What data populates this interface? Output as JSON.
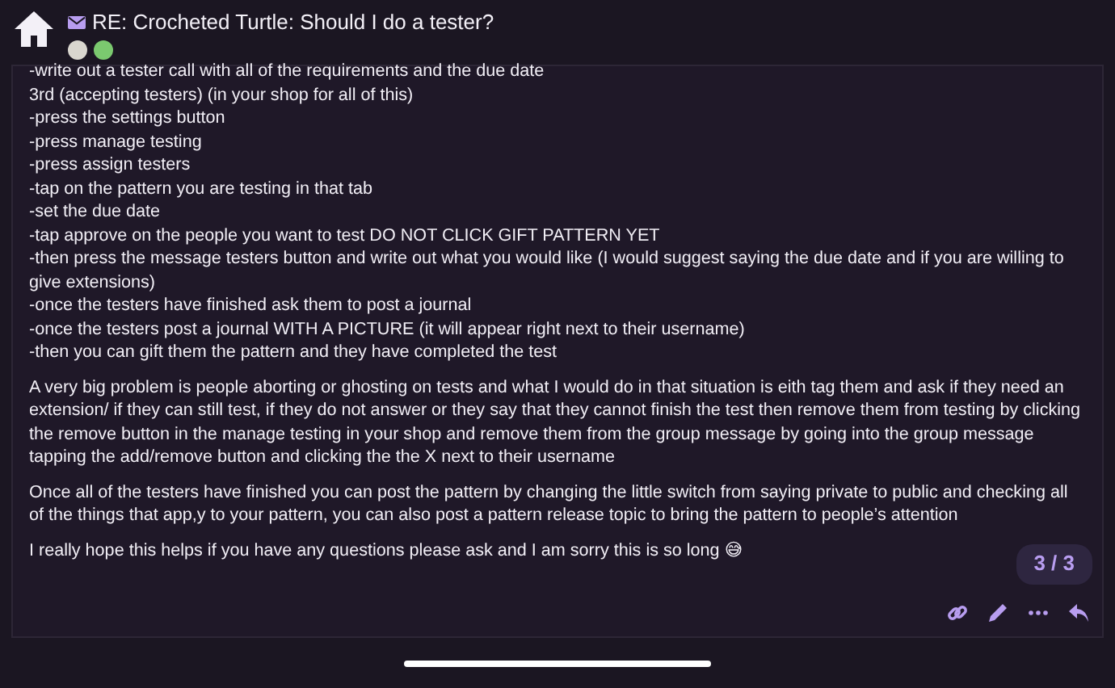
{
  "header": {
    "title": "RE: Crocheted Turtle: Should I do a tester?",
    "avatars": [
      {
        "color": "#d9d6cf"
      },
      {
        "color": "#7bc96f"
      }
    ]
  },
  "post": {
    "lines": [
      "-write out a tester call with all of the requirements and the due date",
      "3rd (accepting testers) (in your shop for all of this)",
      "-press the settings button",
      "-press manage testing",
      "-press assign testers",
      "-tap on the pattern you are testing in that tab",
      "-set the due date",
      "-tap approve on the people you want to test DO NOT CLICK GIFT PATTERN YET",
      "-then press the message testers button and write out what you would like (I would suggest saying the due date and if you are willing to give extensions)",
      "-once the testers have finished ask them to post a journal",
      "-once the testers post a journal WITH A PICTURE (it will appear right next to their username)",
      "-then you can gift them the pattern and they have completed the test"
    ],
    "paragraphs": [
      "A very big problem is people aborting or ghosting on tests and what I would do in that situation is eith tag them and ask if they need an extension/ if they can still test, if they do not answer or they say that they cannot finish the test then remove them from testing by clicking the remove button in the manage testing in your shop and remove them from the group message by going into the group message tapping the add/remove button and clicking the the X next to their username",
      "Once all of the testers have finished you can post the pattern by changing the little switch from saying private to public and checking all of the things that app,y to your pattern, you can also post a pattern release topic to bring the pattern to people’s attention",
      "I really hope this helps if you have any questions please ask and I am sorry this is so long 😅"
    ]
  },
  "progress": "3 / 3",
  "actions": [
    {
      "kind": "link"
    },
    {
      "kind": "edit"
    },
    {
      "kind": "more"
    },
    {
      "kind": "reply"
    }
  ]
}
